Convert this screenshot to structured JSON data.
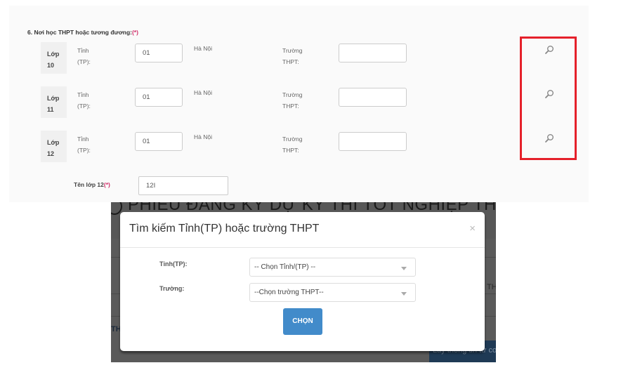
{
  "section": {
    "title": "6. Nơi học THPT hoặc tương đương:",
    "required_mark": "(*)"
  },
  "rows": [
    {
      "grade_word": "Lớp",
      "grade_num": "10",
      "province_label_1": "Tỉnh",
      "province_label_2": "(TP):",
      "province_code": "01",
      "province_name": "Hà Nội",
      "school_label_1": "Trường",
      "school_label_2": "THPT:",
      "school_value": "",
      "search_icon": "search-icon"
    },
    {
      "grade_word": "Lớp",
      "grade_num": "11",
      "province_label_1": "Tỉnh",
      "province_label_2": "(TP):",
      "province_code": "01",
      "province_name": "Hà Nội",
      "school_label_1": "Trường",
      "school_label_2": "THPT:",
      "school_value": "",
      "search_icon": "search-icon"
    },
    {
      "grade_word": "Lớp",
      "grade_num": "12",
      "province_label_1": "Tỉnh",
      "province_label_2": "(TP):",
      "province_code": "01",
      "province_name": "Hà Nội",
      "school_label_1": "Trường",
      "school_label_2": "THPT:",
      "school_value": "",
      "search_icon": "search-icon"
    }
  ],
  "class_name": {
    "label": "Tên lớp 12",
    "required_mark": "(*)",
    "value": "12I"
  },
  "highlight_color": "#e5202a",
  "background": {
    "page_title": "PHIẾU ĐĂNG KÝ DỰ KỲ THI TỐT NGHIỆP THPT",
    "side_text_left": "TH",
    "side_text_right": "TH",
    "fetch_button": "Lấy thông tin từ cơ sở"
  },
  "modal": {
    "title": "Tìm kiếm Tỉnh(TP) hoặc trường THPT",
    "close": "×",
    "province_label": "Tỉnh(TP):",
    "province_selected": "-- Chọn Tỉnh/(TP) --",
    "school_label": "Trường:",
    "school_selected": "--Chọn trường THPT--",
    "submit_label": "CHỌN",
    "button_color": "#428bca"
  }
}
